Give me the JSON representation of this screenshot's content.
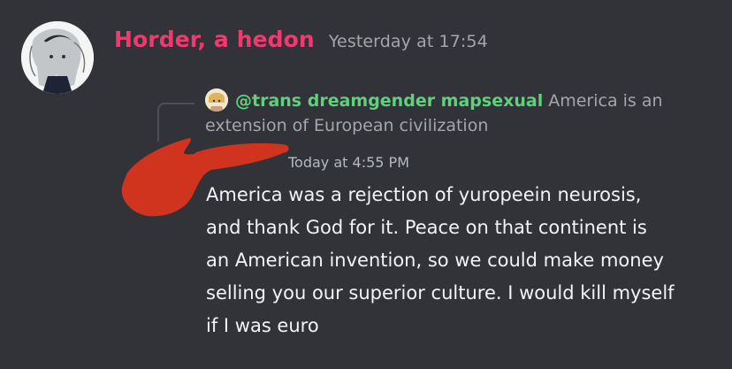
{
  "header": {
    "author": "Horder, a hedon",
    "timestamp": "Yesterday at 17:54",
    "avatar_icon": "anime-character-avatar"
  },
  "reply": {
    "author": "@trans dreamgender mapsexual",
    "text_part1": "America is an",
    "text_part2": "extension of European civilization",
    "avatar_icon": "reply-avatar-icon"
  },
  "message": {
    "time": "Today at 4:55 PM",
    "lines": [
      "America was a rejection of yuropeein neurosis,",
      "and thank God for it. Peace on that continent is",
      "an American invention, so we could make money",
      "selling you our superior culture. I would kill myself",
      "if I was euro"
    ]
  },
  "colors": {
    "background": "#313338",
    "author": "#f2396f",
    "reply_author": "#5fd07b",
    "muted": "#a3a6ac",
    "text": "#f2f3f5",
    "scribble": "#d0341f"
  }
}
